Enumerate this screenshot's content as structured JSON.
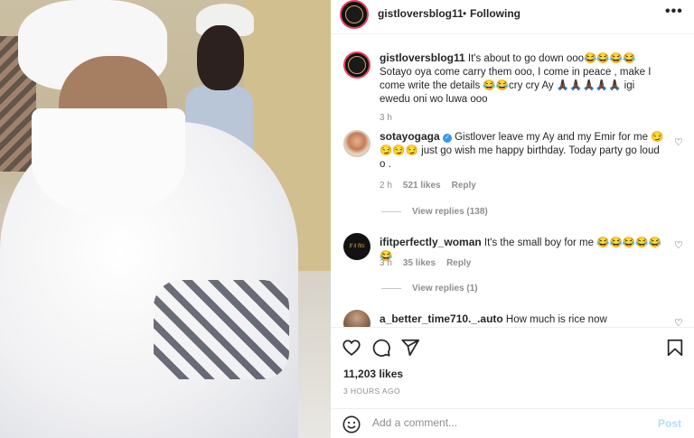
{
  "post": {
    "username": "gistloversblog11",
    "separator": "•",
    "follow_status": "Following",
    "more_icon": "more-horizontal-icon",
    "caption": {
      "username": "gistloversblog11",
      "text": " It's about to go down ooo😂😂😂😂 Sotayo oya come carry them ooo, I come in peace , make I come write the details 😂😂cry cry Ay 🙏🏿🙏🏿🙏🏿🙏🏿🙏🏿 igi ewedu oni wo luwa ooo",
      "time": "3 h"
    }
  },
  "comments": [
    {
      "username": "sotayogaga",
      "verified": true,
      "text": " Gistlover leave my Ay and my Emir for me 😏😏😏😏 just go wish me happy birthday. Today party go loud o .",
      "time": "2 h",
      "likes": "521 likes",
      "reply": "Reply",
      "view_replies": "View replies (138)"
    },
    {
      "username": "ifitperfectly_woman",
      "avatar_text": "If it fits",
      "text": " It's the small boy for me 😂😂😂😂😂😂",
      "time": "3 h",
      "likes": "35 likes",
      "reply": "Reply",
      "view_replies": "View replies (1)"
    },
    {
      "username": "a_better_time710._.auto",
      "text": " How much is rice now"
    }
  ],
  "actions": {
    "like_icon": "heart-icon",
    "comment_icon": "comment-icon",
    "share_icon": "share-icon",
    "save_icon": "bookmark-icon",
    "likes": "11,203 likes",
    "timestamp": "3 HOURS AGO"
  },
  "add_comment": {
    "emoji_icon": "emoji-icon",
    "placeholder": "Add a comment...",
    "post_label": "Post"
  }
}
